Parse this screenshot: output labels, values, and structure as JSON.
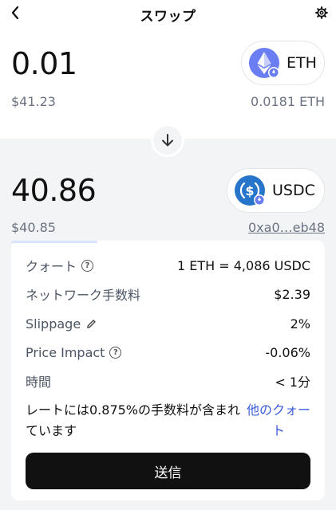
{
  "header": {
    "title": "スワップ",
    "back_icon": "chevron-left-icon",
    "settings_icon": "gear-icon"
  },
  "from": {
    "amount": "0.01",
    "fiat": "$41.23",
    "balance": "0.0181 ETH",
    "token": "ETH",
    "token_color": "#6b7df2"
  },
  "to": {
    "amount": "40.86",
    "fiat": "$40.85",
    "address": "0xa0…eb48",
    "token": "USDC",
    "token_color": "#2775ca"
  },
  "quote": {
    "rows": [
      {
        "label": "クォート",
        "value": "1 ETH = 4,086 USDC"
      },
      {
        "label": "ネットワーク手数料",
        "value": "$2.39"
      },
      {
        "label": "Slippage",
        "value": "2%"
      },
      {
        "label": "Price Impact",
        "value": "-0.06%"
      },
      {
        "label": "時間",
        "value": "< 1分"
      }
    ],
    "fee_notice": "レートには0.875%の手数料が含まれています",
    "other_quote": "他のクォート",
    "send_label": "送信"
  },
  "colors": {
    "accent_link": "#3b5bdb",
    "send_button": "#111111",
    "muted": "#6b7280"
  }
}
